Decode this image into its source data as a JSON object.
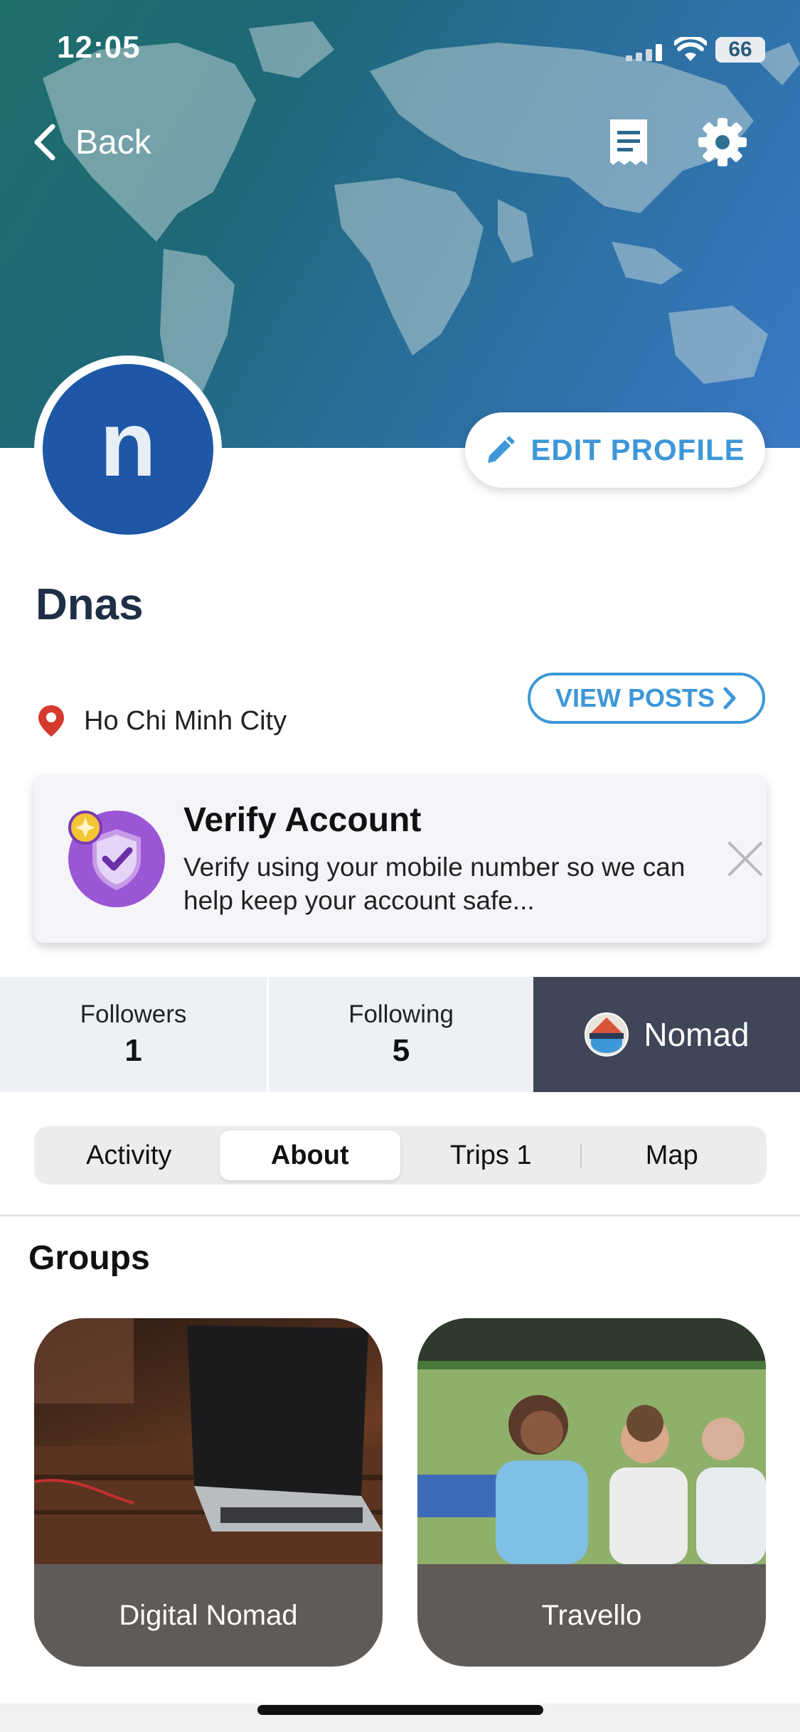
{
  "status_bar": {
    "time": "12:05",
    "battery": "66"
  },
  "nav": {
    "back_label": "Back",
    "icons": [
      "chevron-left-icon",
      "document-icon",
      "gear-icon"
    ]
  },
  "profile": {
    "avatar_letter": "n",
    "name": "Dnas",
    "location": "Ho Chi Minh City",
    "edit_label": "EDIT PROFILE",
    "view_posts_label": "VIEW POSTS"
  },
  "verify": {
    "title": "Verify Account",
    "description": "Verify using your mobile number so we can help keep your account safe..."
  },
  "stats": {
    "followers_label": "Followers",
    "followers_count": "1",
    "following_label": "Following",
    "following_count": "5",
    "badge_label": "Nomad"
  },
  "tabs": [
    {
      "label": "Activity"
    },
    {
      "label": "About",
      "active": true
    },
    {
      "label": "Trips 1"
    },
    {
      "label": "Map"
    }
  ],
  "groups": {
    "heading": "Groups",
    "items": [
      {
        "label": "Digital Nomad"
      },
      {
        "label": "Travello"
      }
    ]
  },
  "colors": {
    "accent": "#3d97d8",
    "avatar": "#1e57a5",
    "badge_bg": "#3f4657",
    "pin": "#d63a2f"
  }
}
